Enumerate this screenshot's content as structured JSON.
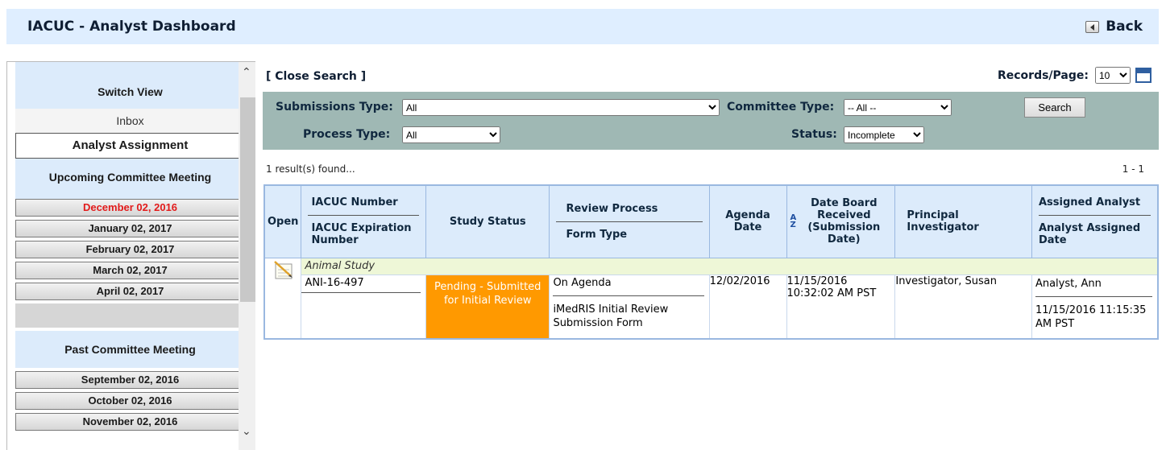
{
  "header": {
    "title": "IACUC - Analyst Dashboard",
    "back_label": "Back"
  },
  "sidebar": {
    "switch_view": "Switch View",
    "inbox": "Inbox",
    "analyst_assignment": "Analyst Assignment",
    "upcoming_title": "Upcoming Committee Meeting",
    "upcoming": [
      "December 02, 2016",
      "January 02, 2017",
      "February 02, 2017",
      "March 02, 2017",
      "April 02, 2017"
    ],
    "past_title": "Past Committee Meeting",
    "past": [
      "September 02, 2016",
      "October 02, 2016",
      "November 02, 2016"
    ]
  },
  "toolbar": {
    "close_search": "[ Close Search ]",
    "records_label": "Records/Page:",
    "records_value": "10"
  },
  "search": {
    "submissions_type_label": "Submissions Type:",
    "submissions_type_value": "All",
    "committee_type_label": "Committee Type:",
    "committee_type_value": "-- All --",
    "process_type_label": "Process Type:",
    "process_type_value": "All",
    "status_label": "Status:",
    "status_value": "Incomplete",
    "search_button": "Search"
  },
  "results": {
    "found": "1 result(s) found...",
    "range": "1 - 1"
  },
  "table": {
    "headers": {
      "open": "Open",
      "iacuc_number": "IACUC Number",
      "iacuc_expiration": "IACUC Expiration Number",
      "study_status": "Study Status",
      "review_process": "Review Process",
      "form_type": "Form Type",
      "agenda_date": "Agenda Date",
      "date_board_received": "Date Board Received (Submission Date)",
      "principal_investigator": "Principal Investigator",
      "assigned_analyst": "Assigned Analyst",
      "analyst_assigned_date": "Analyst Assigned Date"
    },
    "group": "Animal Study",
    "rows": [
      {
        "iacuc_number": "ANI-16-497",
        "study_status": "Pending - Submitted for Initial Review",
        "review_process": "On Agenda",
        "form_type": "iMedRIS Initial Review Submission Form",
        "agenda_date": "12/02/2016",
        "date_received": "11/15/2016 10:32:02 AM PST",
        "investigator": "Investigator, Susan",
        "analyst": "Analyst, Ann",
        "assigned_date": "11/15/2016 11:15:35 AM PST"
      }
    ]
  },
  "colors": {
    "header_bg": "#dfeeff",
    "panel_bg": "#9fb8b4",
    "status_orange": "#ff9900",
    "meeting_red": "#e21b1b",
    "group_row": "#eef7d7"
  }
}
